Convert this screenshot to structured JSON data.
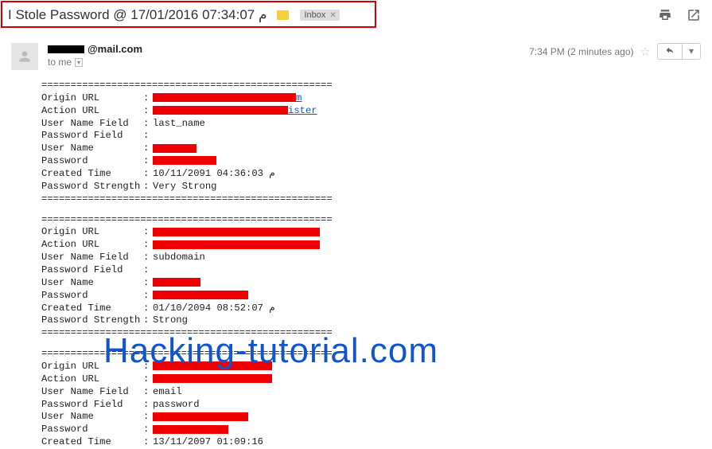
{
  "subject": "I Stole Password @ 17/01/2016 07:34:07 م",
  "inbox_label": "Inbox",
  "sender": {
    "redacted_prefix": true,
    "domain": "@mail.com"
  },
  "to_line": "to me",
  "timestamp": "7:34 PM (2 minutes ago)",
  "watermark": "Hacking-tutorial.com",
  "separator": "==================================================",
  "labels": {
    "origin_url": "Origin URL",
    "action_url": "Action URL",
    "user_name_field": "User Name Field",
    "password_field": "Password Field",
    "user_name": "User Name",
    "password": "Password",
    "created_time": "Created Time",
    "password_strength": "Password Strength"
  },
  "records": [
    {
      "origin_url": {
        "redacted_w": 180,
        "suffix": "m",
        "link": true
      },
      "action_url": {
        "redacted_w": 170,
        "suffix": "ister",
        "link": true
      },
      "user_name_field": "last_name",
      "password_field": "",
      "user_name": {
        "redacted_w": 55
      },
      "password": {
        "redacted_w": 80
      },
      "created_time": "10/11/2091 04:36:03 م",
      "password_strength": "Very Strong"
    },
    {
      "origin_url": {
        "redacted_w": 210
      },
      "action_url": {
        "redacted_w": 210
      },
      "user_name_field": "subdomain",
      "password_field": "",
      "user_name": {
        "redacted_w": 60
      },
      "password": {
        "redacted_w": 120
      },
      "created_time": "01/10/2094 08:52:07 م",
      "password_strength": "Strong"
    },
    {
      "origin_url": {
        "redacted_w": 150
      },
      "action_url": {
        "redacted_w": 150
      },
      "user_name_field": "email",
      "password_field": "password",
      "user_name": {
        "redacted_w": 120
      },
      "password": {
        "redacted_w": 95
      },
      "created_time": "13/11/2097 01:09:16",
      "password_strength": ""
    }
  ]
}
